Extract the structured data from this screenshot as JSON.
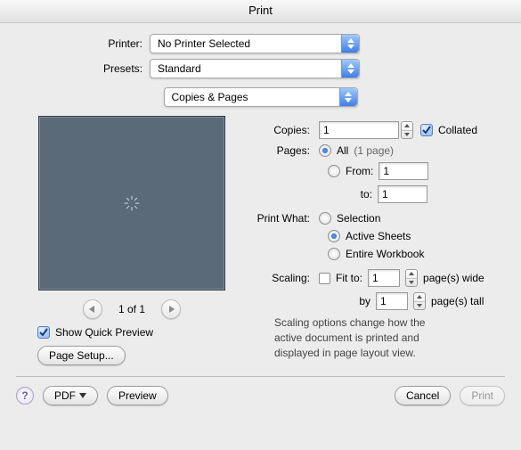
{
  "title": "Print",
  "printer": {
    "label": "Printer:",
    "value": "No Printer Selected"
  },
  "presets": {
    "label": "Presets:",
    "value": "Standard"
  },
  "section": "Copies & Pages",
  "copies": {
    "label": "Copies:",
    "value": "1",
    "collated": "Collated"
  },
  "pages": {
    "label": "Pages:",
    "all": "All",
    "count": "(1 page)",
    "from_label": "From:",
    "from_value": "1",
    "to_label": "to:",
    "to_value": "1"
  },
  "print_what": {
    "label": "Print What:",
    "selection": "Selection",
    "active": "Active Sheets",
    "workbook": "Entire Workbook"
  },
  "scaling": {
    "label": "Scaling:",
    "fit_to": "Fit to:",
    "wide_value": "1",
    "wide_suffix": "page(s) wide",
    "by": "by",
    "tall_value": "1",
    "tall_suffix": "page(s) tall",
    "note": "Scaling options change how the active document is printed and displayed in page layout view."
  },
  "preview": {
    "page_indicator": "1 of 1",
    "show_quick": "Show Quick Preview",
    "page_setup": "Page Setup..."
  },
  "footer": {
    "pdf": "PDF",
    "preview": "Preview",
    "cancel": "Cancel",
    "print": "Print"
  }
}
